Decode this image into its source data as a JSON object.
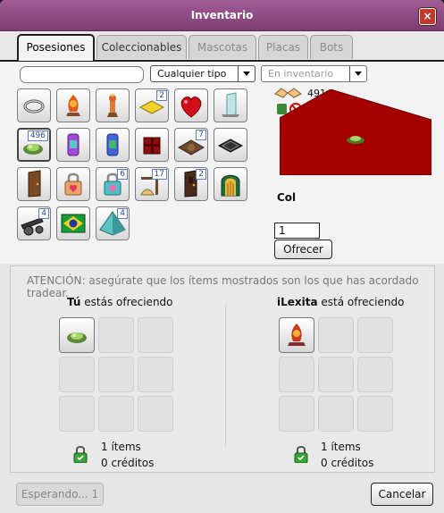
{
  "window": {
    "title": "Inventario",
    "close_label": "×"
  },
  "tabs": [
    {
      "label": "Posesiones",
      "state": "active"
    },
    {
      "label": "Coleccionables",
      "state": "normal"
    },
    {
      "label": "Mascotas",
      "state": "disabled"
    },
    {
      "label": "Placas",
      "state": "disabled"
    },
    {
      "label": "Bots",
      "state": "disabled"
    }
  ],
  "filters": {
    "search_value": "",
    "type_select": "Cualquier tipo",
    "location_select": "En inventario"
  },
  "grid_counts": {
    "ceiling_lamp": "2",
    "lettuce": "496",
    "rug": "7",
    "gift_lock": "6",
    "shower": "17",
    "door": "2",
    "cannon": "4",
    "pyramid": "4"
  },
  "preview": {
    "credits": "491",
    "item_name": "Col",
    "quantity": "1",
    "offer_button": "Ofrecer"
  },
  "trade": {
    "notice": "ATENCIÓN: asegúrate que los ítems mostrados son los que has acordado tradear.",
    "left": {
      "owner": "Tú",
      "offering_text": "estás ofreciendo",
      "items": "1 ítems",
      "credits": "0 créditos"
    },
    "right": {
      "owner": "iLexita",
      "offering_text": "está ofreciendo",
      "items": "1 ítems",
      "credits": "0 créditos"
    }
  },
  "footer": {
    "waiting_button": "Esperando... 1",
    "cancel_button": "Cancelar"
  },
  "colors": {
    "title_bar": "#8d4884",
    "floor": "#a50000",
    "badge_text": "#2a4c98",
    "lock_green": "#3aa53a"
  }
}
